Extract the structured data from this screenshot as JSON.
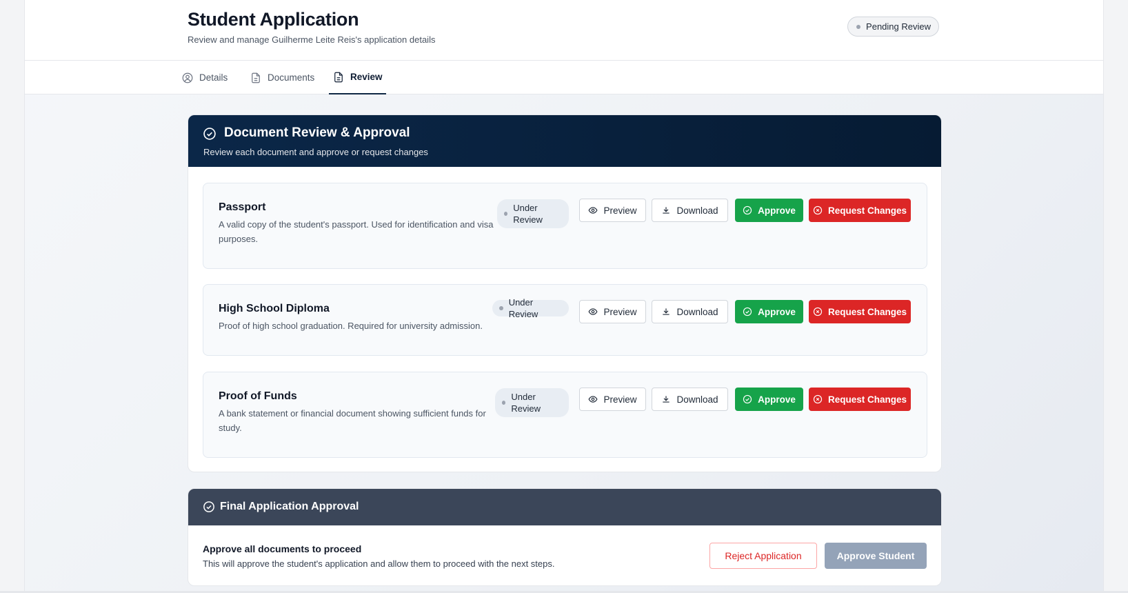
{
  "header": {
    "title": "Student Application",
    "subtitle": "Review and manage Guilherme Leite Reis's application details",
    "status": "Pending Review"
  },
  "tabs": [
    {
      "label": "Details",
      "icon": "user-circle-icon"
    },
    {
      "label": "Documents",
      "icon": "document-icon"
    },
    {
      "label": "Review",
      "icon": "document-icon",
      "active": true
    }
  ],
  "review": {
    "title": "Document Review & Approval",
    "subtitle": "Review each document and approve or request changes",
    "documents": [
      {
        "title": "Passport",
        "description": "A valid copy of the student's passport. Used for identification and visa purposes.",
        "status": "Under Review"
      },
      {
        "title": "High School Diploma",
        "description": "Proof of high school graduation. Required for university admission.",
        "status": "Under Review"
      },
      {
        "title": "Proof of Funds",
        "description": "A bank statement or financial document showing sufficient funds for study.",
        "status": "Under Review"
      }
    ],
    "buttons": {
      "preview": "Preview",
      "download": "Download",
      "approve": "Approve",
      "request_changes": "Request Changes"
    }
  },
  "final": {
    "title": "Final Application Approval",
    "heading": "Approve all documents to proceed",
    "description": "This will approve the student's application and allow them to proceed with the next steps.",
    "reject_label": "Reject Application",
    "approve_label": "Approve Student"
  },
  "colors": {
    "navy": "#0b2748",
    "green": "#16a34a",
    "red": "#dc2626",
    "slate": "#3b4659",
    "disabled": "#94a3b8"
  }
}
